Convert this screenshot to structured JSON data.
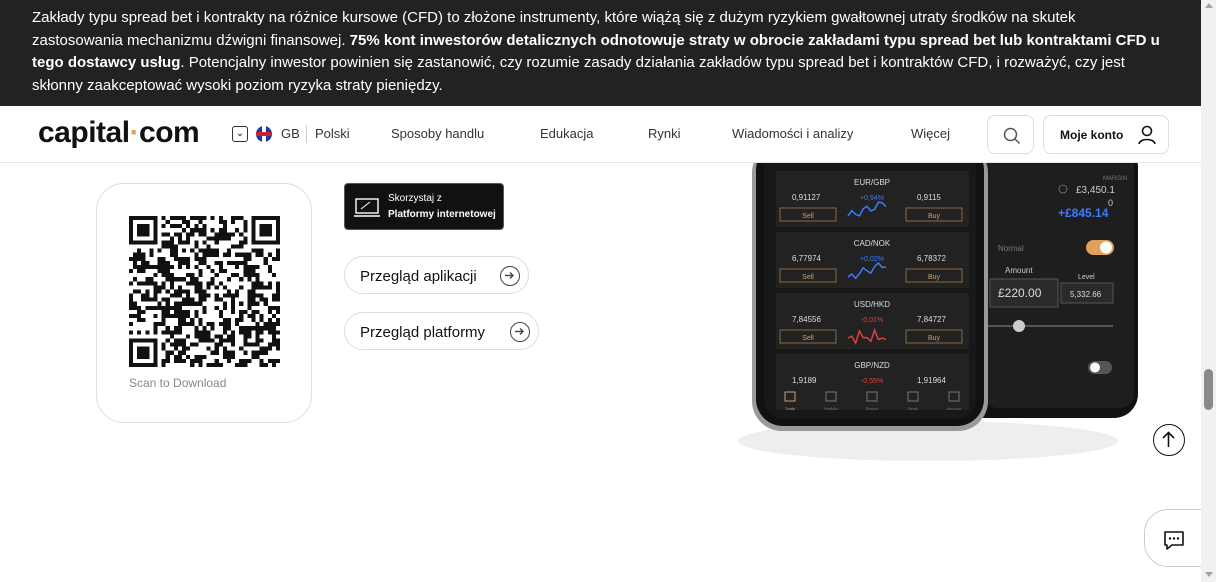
{
  "risk": {
    "text_a": "Zakłady typu spread bet i kontrakty na różnice kursowe (CFD) to złożone instrumenty, które wiążą się z dużym ryzykiem gwałtownej utraty środków na skutek zastosowania mechanizmu dźwigni finansowej. ",
    "text_bold": "75% kont inwestorów detalicznych odnotowuje straty w obrocie zakładami typu spread bet lub kontraktami CFD u tego dostawcy usług",
    "text_b": ". Potencjalny inwestor powinien się zastanowić, czy rozumie zasady działania zakładów typu spread bet i kontraktów CFD, i rozważyć, czy jest skłonny zaakceptować wysoki poziom ryzyka straty pieniędzy."
  },
  "header": {
    "logo_a": "capital",
    "logo_dot": "·",
    "logo_b": "com",
    "country": "GB",
    "language": "Polski",
    "nav": [
      "Sposoby handlu",
      "Edukacja",
      "Rynki",
      "Wiadomości i analizy",
      "Więcej"
    ],
    "account": "Moje konto"
  },
  "qr": {
    "caption": "Scan to Download"
  },
  "platform_button": {
    "line1": "Skorzystaj z",
    "line2": "Platformy internetowej"
  },
  "links": {
    "app_review": "Przegląd aplikacji",
    "platform_review": "Przegląd platformy"
  },
  "phone": {
    "rows": [
      {
        "pair": "EUR/GBP",
        "sell": "0,91127",
        "change": "+0,94%",
        "buy": "0,9115",
        "up": true
      },
      {
        "pair": "CAD/NOK",
        "sell": "6,77974",
        "change": "+0,02%",
        "buy": "6,78372",
        "up": true
      },
      {
        "pair": "USD/HKD",
        "sell": "7,84556",
        "change": "-0,01%",
        "buy": "7,84727",
        "up": false
      },
      {
        "pair": "GBP/NZD",
        "sell": "1,9189",
        "change": "-0,55%",
        "buy": "1,91964",
        "up": false
      }
    ],
    "sell_label": "Sell",
    "buy_label": "Buy",
    "tabs": [
      "Trade",
      "Portfolio",
      "Search",
      "News",
      "Account"
    ],
    "right": {
      "label_top": "MARGIN",
      "value1": "£3,450.1",
      "value_zero": "0",
      "value2": "+£845.14",
      "mode": "Normal",
      "amount_label": "Amount",
      "level_label": "Level",
      "amount": "£220.00",
      "level": "5,332.66"
    }
  },
  "colors": {
    "banner_bg": "#222222",
    "accent": "#e0a25a",
    "up": "#3d7bff",
    "down": "#e04040"
  }
}
